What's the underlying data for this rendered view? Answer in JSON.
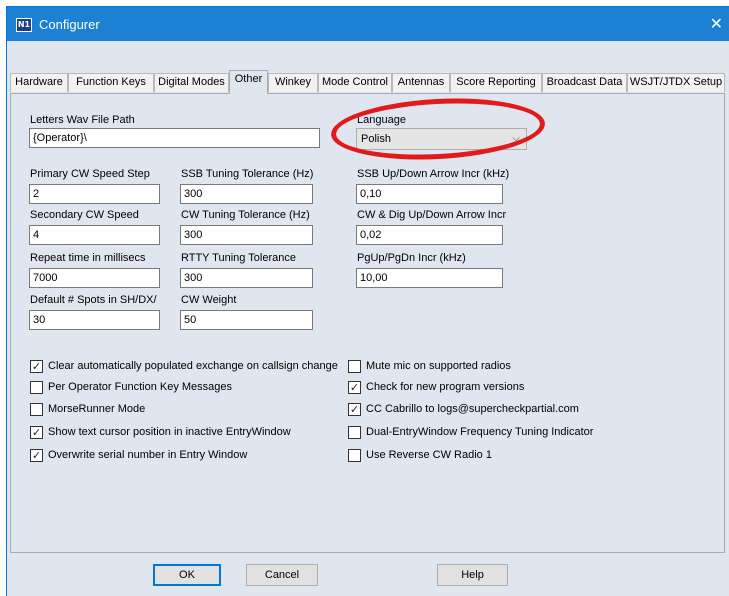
{
  "window": {
    "title": "Configurer",
    "icon_text": "N1"
  },
  "tabs": [
    {
      "label": "Hardware"
    },
    {
      "label": "Function Keys"
    },
    {
      "label": "Digital Modes"
    },
    {
      "label": "Other"
    },
    {
      "label": "Winkey"
    },
    {
      "label": "Mode Control"
    },
    {
      "label": "Antennas"
    },
    {
      "label": "Score Reporting"
    },
    {
      "label": "Broadcast Data"
    },
    {
      "label": "WSJT/JTDX Setup"
    }
  ],
  "active_tab": "Other",
  "fields": {
    "letters_wav": {
      "label": "Letters Wav File Path",
      "value": "{Operator}\\"
    },
    "language": {
      "label": "Language",
      "value": "Polish"
    },
    "primary_cw_step": {
      "label": "Primary CW Speed Step",
      "value": "2"
    },
    "ssb_tuning_tol": {
      "label": "SSB Tuning Tolerance (Hz)",
      "value": "300"
    },
    "ssb_arrow_incr": {
      "label": "SSB Up/Down Arrow Incr (kHz)",
      "value": "0,10"
    },
    "secondary_cw_speed": {
      "label": "Secondary CW Speed",
      "value": "4"
    },
    "cw_tuning_tol": {
      "label": "CW Tuning Tolerance (Hz)",
      "value": "300"
    },
    "cw_dig_arrow_incr": {
      "label": "CW & Dig Up/Down Arrow Incr",
      "value": "0,02"
    },
    "repeat_time": {
      "label": "Repeat time in millisecs",
      "value": "7000"
    },
    "rtty_tuning_tol": {
      "label": "RTTY Tuning Tolerance",
      "value": "300"
    },
    "pgup_pgdn_incr": {
      "label": "PgUp/PgDn Incr (kHz)",
      "value": "10,00"
    },
    "default_spots": {
      "label": "Default # Spots in SH/DX/",
      "value": "30"
    },
    "cw_weight": {
      "label": "CW Weight",
      "value": "50"
    }
  },
  "checkboxes_left": [
    {
      "label": "Clear automatically populated exchange on callsign change",
      "checked": true,
      "mark": "✓"
    },
    {
      "label": "Per Operator Function Key Messages",
      "checked": false,
      "mark": ""
    },
    {
      "label": "MorseRunner Mode",
      "checked": false,
      "mark": ""
    },
    {
      "label": "Show text cursor position in inactive EntryWindow",
      "checked": true,
      "mark": "✓"
    },
    {
      "label": "Overwrite serial number in Entry Window",
      "checked": true,
      "mark": "✓"
    }
  ],
  "checkboxes_right": [
    {
      "label": "Mute mic on supported radios",
      "checked": false,
      "mark": ""
    },
    {
      "label": "Check for new program versions",
      "checked": true,
      "mark": "✓"
    },
    {
      "label": "CC Cabrillo to logs@supercheckpartial.com",
      "checked": true,
      "mark": "✓"
    },
    {
      "label": "Dual-EntryWindow Frequency Tuning Indicator",
      "checked": false,
      "mark": ""
    },
    {
      "label": "Use Reverse CW Radio 1",
      "checked": false,
      "mark": ""
    }
  ],
  "buttons": {
    "ok": "OK",
    "cancel": "Cancel",
    "help": "Help"
  },
  "colors": {
    "titlebar": "#1c81d5",
    "panel": "#dfe6ef",
    "highlight_circle": "#e11a1a",
    "default_button_border": "#0078d7"
  }
}
